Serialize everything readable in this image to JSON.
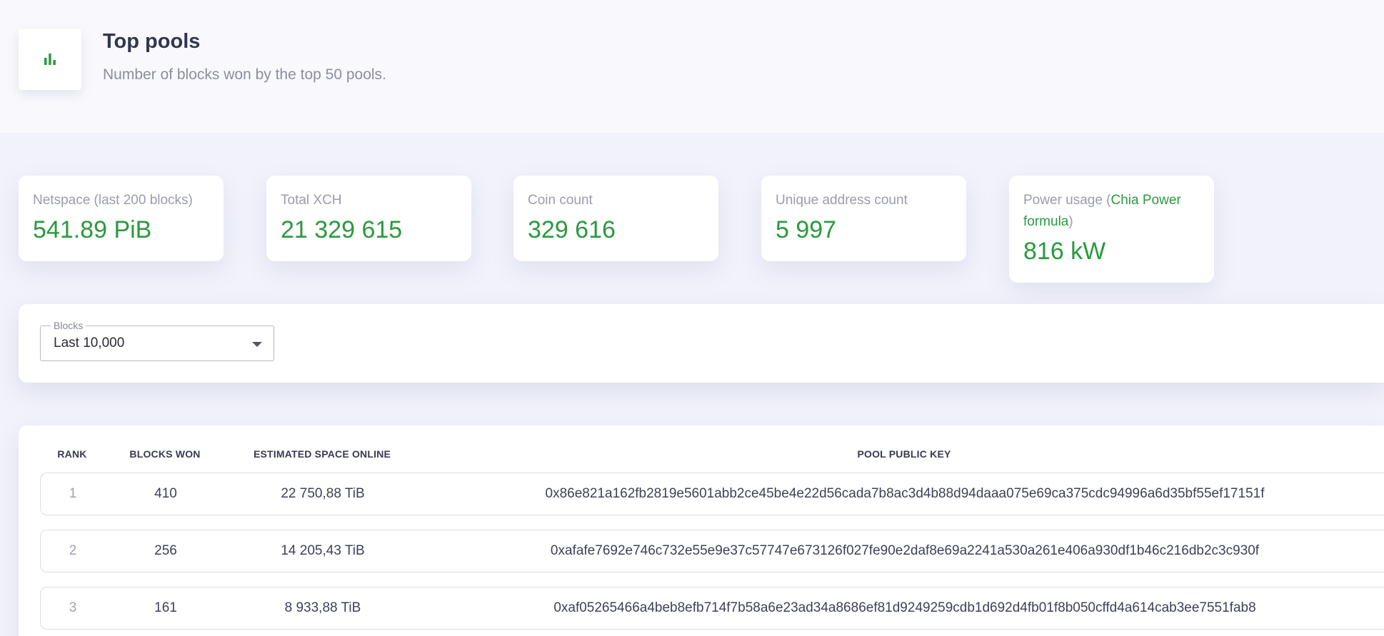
{
  "header": {
    "title": "Top pools",
    "subtitle": "Number of blocks won by the top 50 pools.",
    "icon": "bar-chart-icon",
    "accent": "#2a9a3e"
  },
  "stats": [
    {
      "label": "Netspace (last 200 blocks)",
      "value": "541.89 PiB"
    },
    {
      "label": "Total XCH",
      "value": "21 329 615"
    },
    {
      "label": "Coin count",
      "value": "329 616"
    },
    {
      "label": "Unique address count",
      "value": "5 997"
    },
    {
      "label_prefix": "Power usage (",
      "label_link": "Chia Power formula",
      "label_suffix": ")",
      "value": "816 kW"
    }
  ],
  "filter": {
    "legend": "Blocks",
    "selected": "Last 10,000"
  },
  "table": {
    "columns": [
      "RANK",
      "BLOCKS WON",
      "ESTIMATED SPACE ONLINE",
      "POOL PUBLIC KEY"
    ],
    "rows": [
      {
        "rank": "1",
        "blocks_won": "410",
        "space": "22 750,88 TiB",
        "key": "0x86e821a162fb2819e5601abb2ce45be4e22d56cada7b8ac3d4b88d94daaa075e69ca375cdc94996a6d35bf55ef17151f"
      },
      {
        "rank": "2",
        "blocks_won": "256",
        "space": "14 205,43 TiB",
        "key": "0xafafe7692e746c732e55e9e37c57747e673126f027fe90e2daf8e69a2241a530a261e406a930df1b46c216db2c3c930f"
      },
      {
        "rank": "3",
        "blocks_won": "161",
        "space": "8 933,88 TiB",
        "key": "0xaf05265466a4beb8efb714f7b58a6e23ad34a8686ef81d9249259cdb1d692d4fb01f8b050cffd4a614cab3ee7551fab8"
      }
    ]
  }
}
